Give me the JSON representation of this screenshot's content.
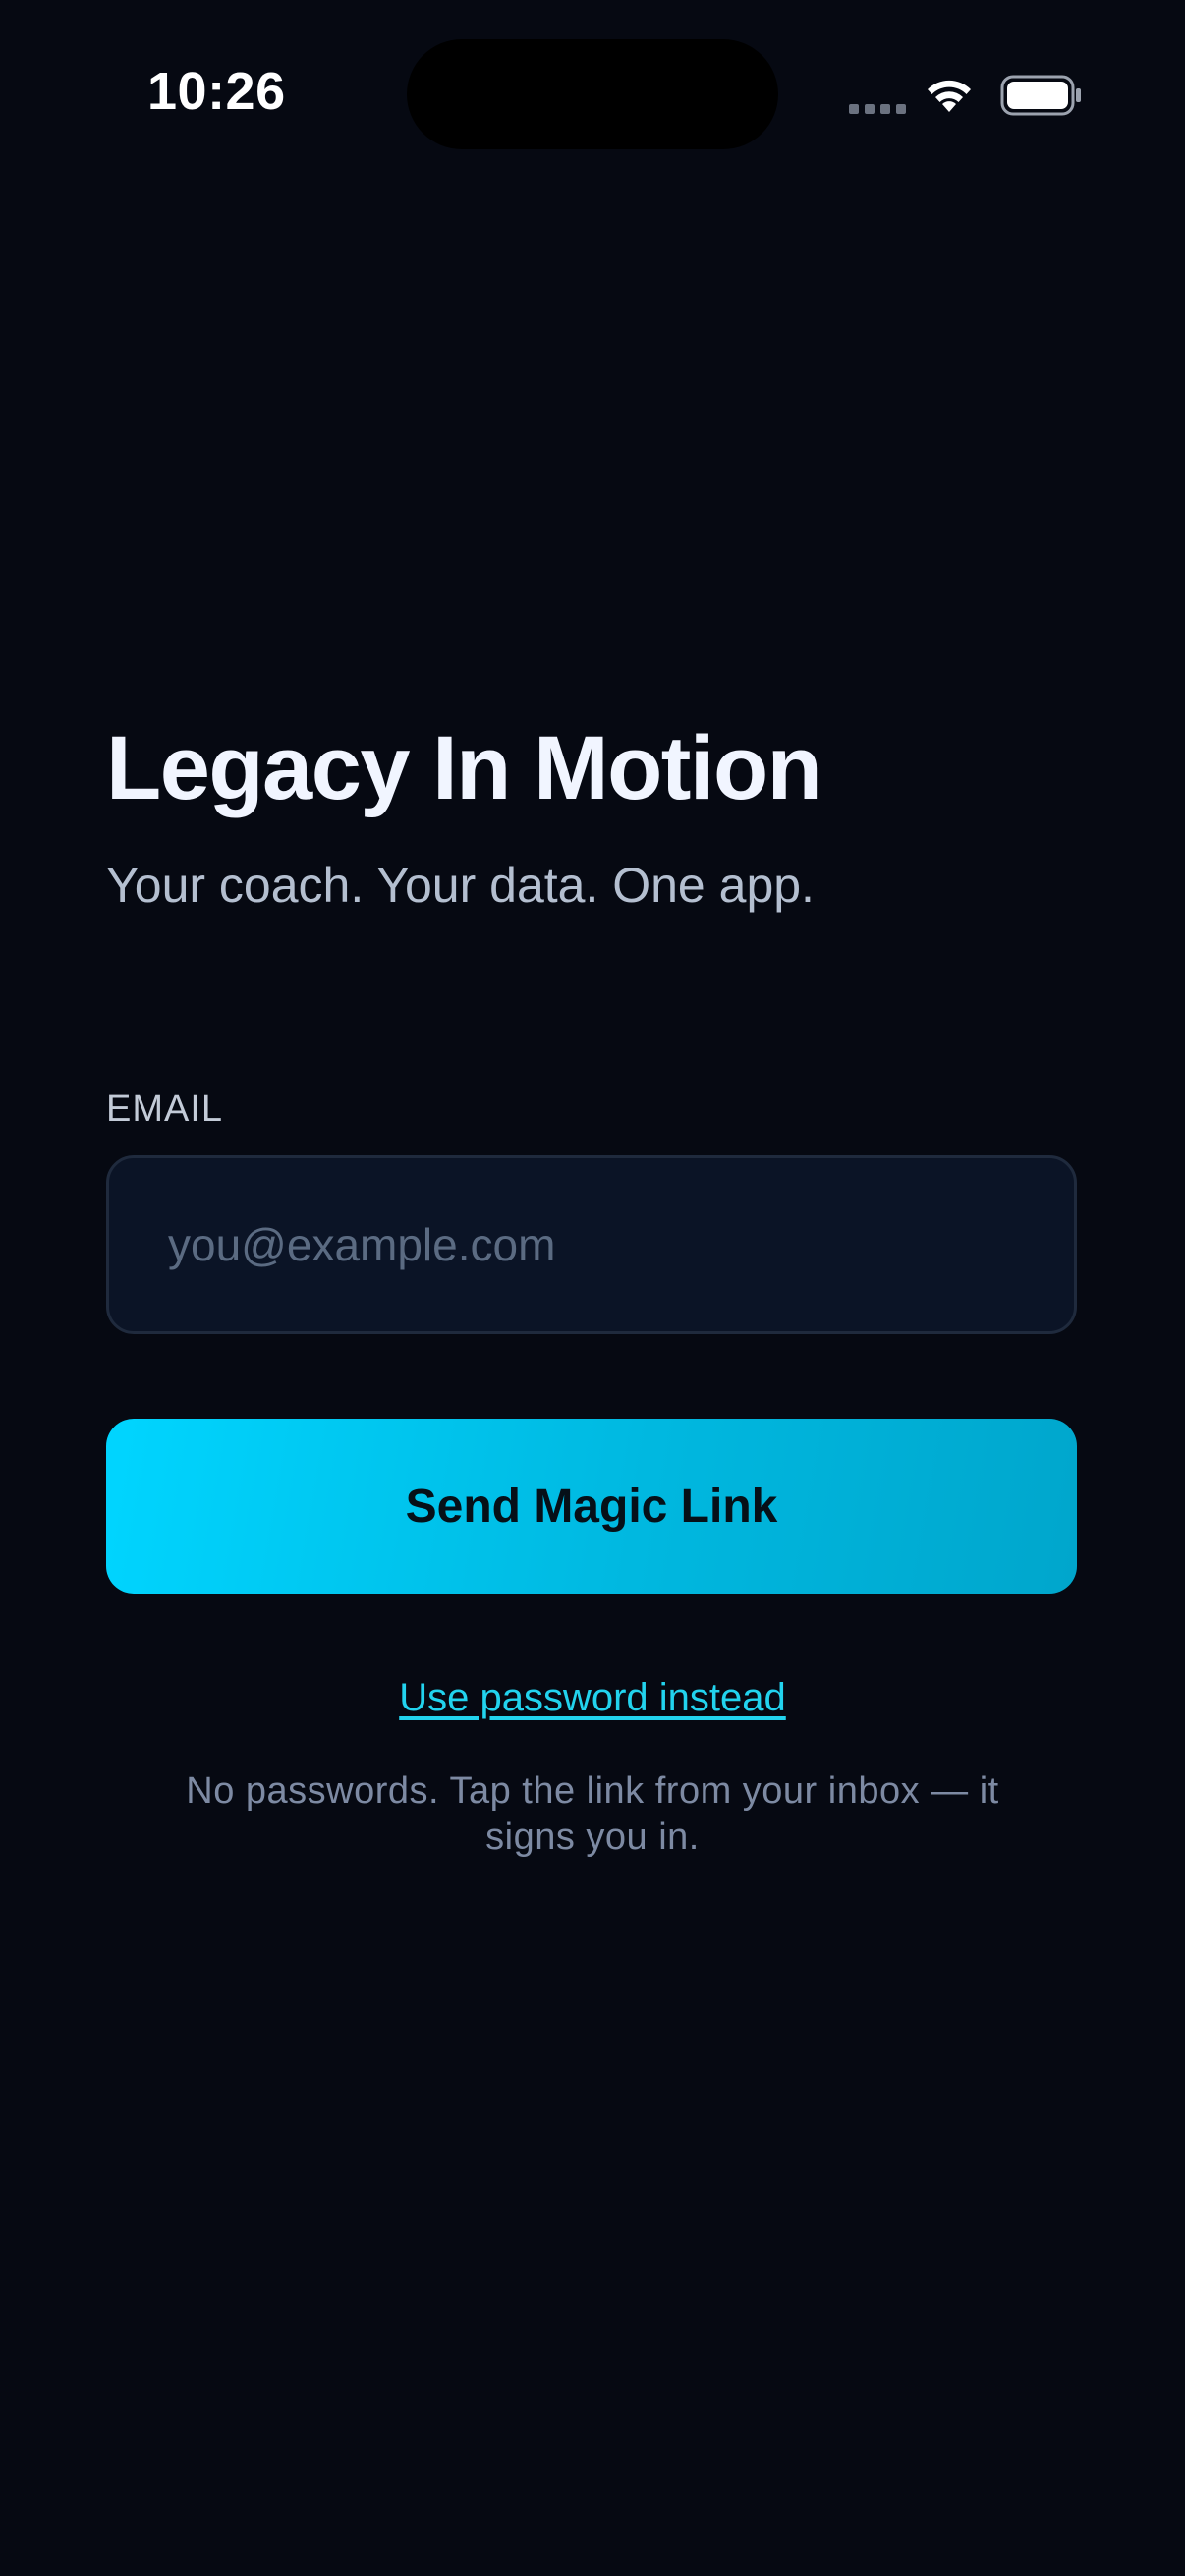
{
  "status_bar": {
    "time": "10:26"
  },
  "app": {
    "title": "Legacy In Motion",
    "subtitle": "Your coach. Your data. One app."
  },
  "form": {
    "email_label": "EMAIL",
    "email_value": "",
    "email_placeholder": "you@example.com",
    "send_button_label": "Send Magic Link",
    "password_link_label": "Use password instead",
    "helper_text": "No passwords. Tap the link from your inbox — it signs you in."
  },
  "icons": {
    "wifi": "wifi-icon",
    "battery": "battery-icon",
    "signal": "cellular-signal-icon"
  },
  "colors": {
    "background": "#060912",
    "accent": "#00d5ff",
    "link": "#22d3ee",
    "field_background": "#0b1426"
  }
}
